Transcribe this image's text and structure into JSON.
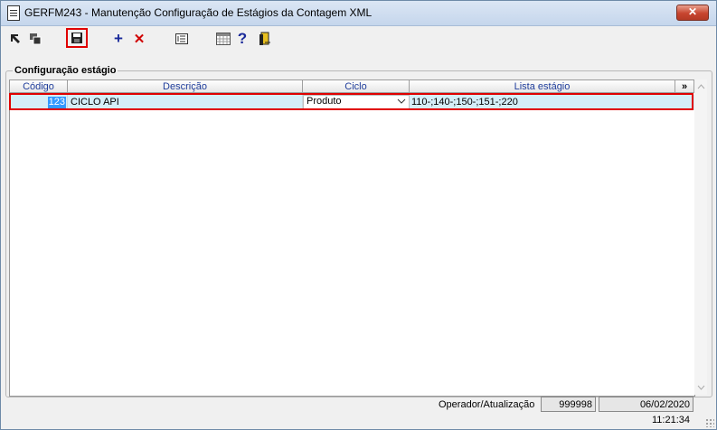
{
  "window": {
    "title": "GERFM243 - Manutenção Configuração de Estágios da Contagem XML",
    "close_label": "✕"
  },
  "toolbar": {
    "icons": [
      "first-record-icon",
      "copy-icon",
      "save-icon",
      "add-icon",
      "delete-icon",
      "list-icon",
      "calendar-icon",
      "help-icon",
      "exit-icon"
    ],
    "add_label": "+",
    "delete_label": "✕",
    "help_label": "?"
  },
  "group": {
    "label": "Configuração estágio"
  },
  "grid": {
    "columns": [
      "Código",
      "Descrição",
      "Ciclo",
      "Lista estágio"
    ],
    "expand_label": "»",
    "rows": [
      {
        "codigo": "123",
        "descricao": "CICLO API",
        "ciclo": "Produto",
        "lista_estagio": "110-;140-;150-;151-;220"
      }
    ]
  },
  "status": {
    "label": "Operador/Atualização",
    "operador": "999998",
    "atualizacao": "06/02/2020 11:21:34"
  },
  "colors": {
    "highlight": "#e00000",
    "selected_row": "#d5eef8",
    "header_text": "#1f3d9b"
  }
}
